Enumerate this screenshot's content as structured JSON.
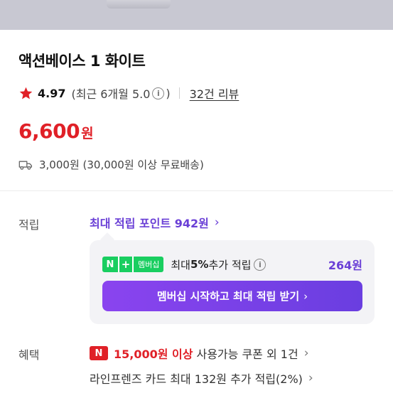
{
  "product": {
    "title": "액션베이스 1 화이트",
    "rating": "4.97",
    "recent_rating": "(최근 6개월 5.0",
    "recent_close": ")",
    "review_count": "32건 리뷰",
    "price_number": "6,600",
    "price_unit": "원",
    "shipping": "3,000원 (30,000원 이상 무료배송)"
  },
  "points": {
    "label": "적립",
    "max_points_link": "최대 적립 포인트 942원",
    "membership_badge_n": "N",
    "membership_badge_plus": "+",
    "membership_badge_text": "멤버십",
    "extra_prefix": "최대 ",
    "extra_percent": "5%",
    "extra_suffix": " 추가 적립",
    "extra_amount": "264원",
    "cta_label": "멤버십 시작하고 최대 적립 받기"
  },
  "benefits": {
    "label": "혜택",
    "naver_badge": "N",
    "coupon_amount": "15,000원 이상",
    "coupon_rest": "사용가능 쿠폰 외 1건",
    "card_text": "라인프렌즈 카드 최대 132원 추가 적립(2%)"
  },
  "icons": {
    "star": "star-icon",
    "info": "info-icon",
    "truck": "truck-icon",
    "chevron": "chevron-right-icon"
  },
  "colors": {
    "price_red": "#e02027",
    "accent_purple": "#6a3fd6",
    "naver_green": "#19ce60",
    "star_red": "#e02027"
  }
}
